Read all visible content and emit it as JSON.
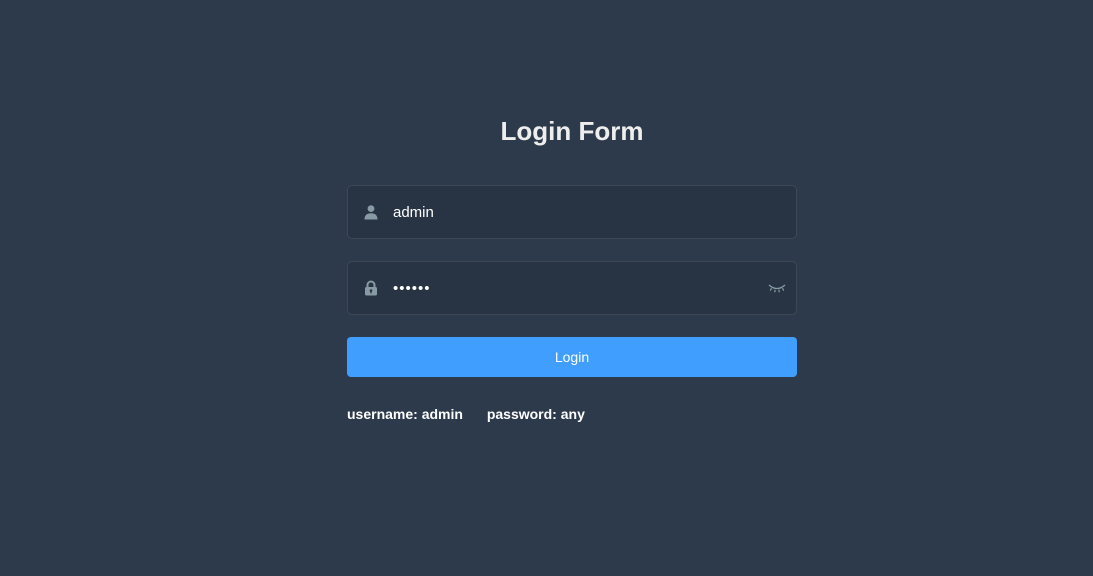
{
  "title": "Login Form",
  "username": {
    "value": "admin",
    "icon": "user-icon"
  },
  "password": {
    "value": "123456",
    "icon": "lock-icon",
    "toggle_icon": "eye-closed-icon"
  },
  "login_button": {
    "label": "Login"
  },
  "tips": {
    "username": "username: admin",
    "password": "password: any"
  },
  "colors": {
    "background": "#2d3a4b",
    "input_background": "#283443",
    "primary": "#409eff",
    "icon": "#889aa4"
  }
}
